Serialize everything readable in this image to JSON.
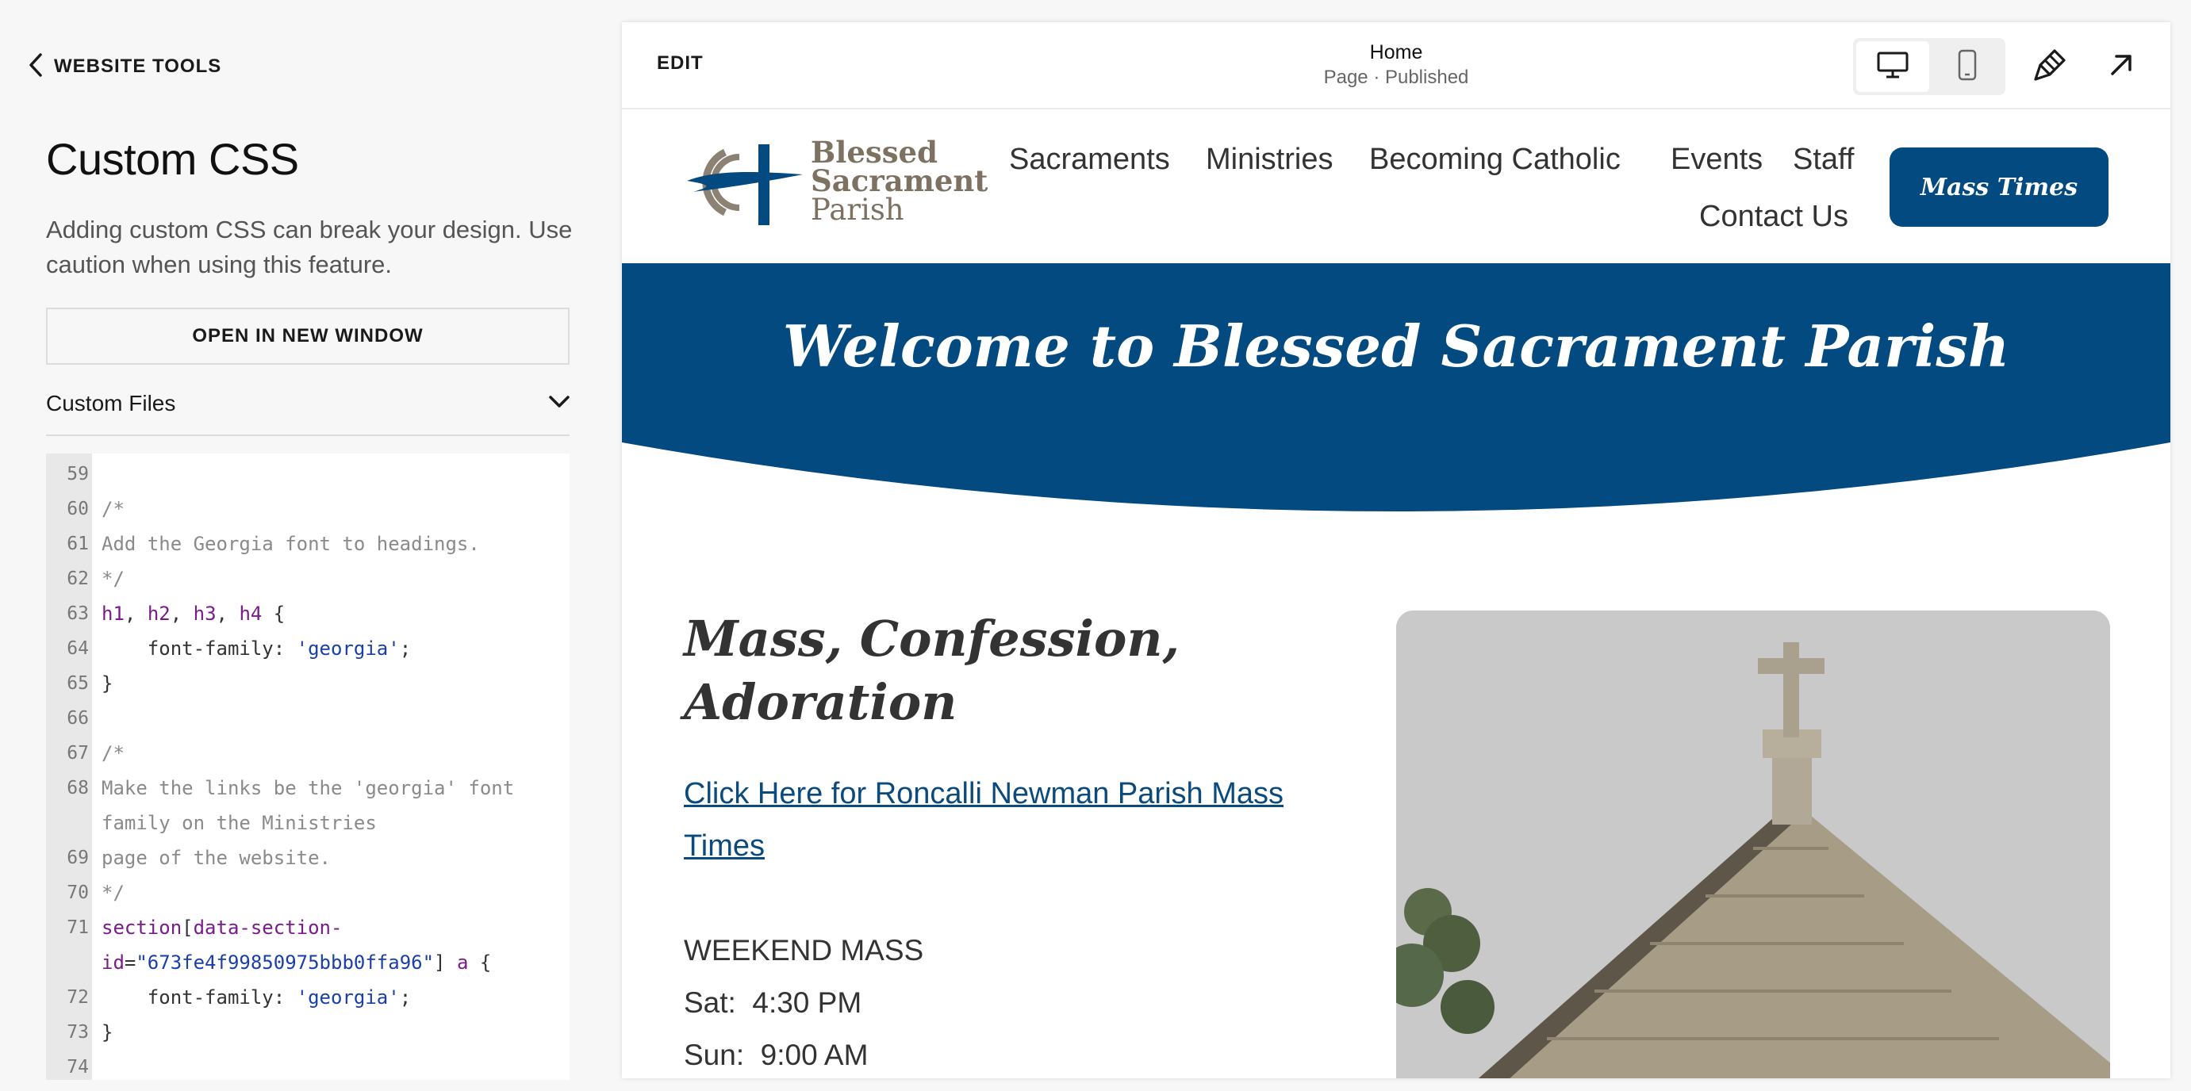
{
  "panel": {
    "back_label": "WEBSITE TOOLS",
    "title": "Custom CSS",
    "description": "Adding custom CSS can break your design. Use caution when using this feature.",
    "open_button": "OPEN IN NEW WINDOW",
    "custom_files_label": "Custom Files"
  },
  "editor": {
    "lines": [
      {
        "n": "59",
        "segments": []
      },
      {
        "n": "60",
        "segments": [
          {
            "t": "/*",
            "k": "comment"
          }
        ]
      },
      {
        "n": "61",
        "segments": [
          {
            "t": "Add the Georgia font to headings.",
            "k": "comment"
          }
        ]
      },
      {
        "n": "62",
        "segments": [
          {
            "t": "*/",
            "k": "comment"
          }
        ]
      },
      {
        "n": "63",
        "segments": [
          {
            "t": "h1",
            "k": "sel"
          },
          {
            "t": ", ",
            "k": "plain"
          },
          {
            "t": "h2",
            "k": "sel"
          },
          {
            "t": ", ",
            "k": "plain"
          },
          {
            "t": "h3",
            "k": "sel"
          },
          {
            "t": ", ",
            "k": "plain"
          },
          {
            "t": "h4",
            "k": "sel"
          },
          {
            "t": " {",
            "k": "plain"
          }
        ]
      },
      {
        "n": "64",
        "segments": [
          {
            "t": "    font-family: ",
            "k": "plain"
          },
          {
            "t": "'georgia'",
            "k": "str"
          },
          {
            "t": ";",
            "k": "plain"
          }
        ]
      },
      {
        "n": "65",
        "segments": [
          {
            "t": "}",
            "k": "plain"
          }
        ]
      },
      {
        "n": "66",
        "segments": []
      },
      {
        "n": "67",
        "segments": [
          {
            "t": "/*",
            "k": "comment"
          }
        ]
      },
      {
        "n": "68",
        "segments": [
          {
            "t": "Make the links be the 'georgia' font",
            "k": "comment"
          }
        ]
      },
      {
        "n": "",
        "segments": [
          {
            "t": "family on the Ministries",
            "k": "comment"
          }
        ]
      },
      {
        "n": "69",
        "segments": [
          {
            "t": "page of the website.",
            "k": "comment"
          }
        ]
      },
      {
        "n": "70",
        "segments": [
          {
            "t": "*/",
            "k": "comment"
          }
        ]
      },
      {
        "n": "71",
        "segments": [
          {
            "t": "section",
            "k": "sel"
          },
          {
            "t": "[",
            "k": "plain"
          },
          {
            "t": "data-section-",
            "k": "sel"
          }
        ]
      },
      {
        "n": "",
        "segments": [
          {
            "t": "id",
            "k": "sel"
          },
          {
            "t": "=",
            "k": "plain"
          },
          {
            "t": "\"673fe4f99850975bbb0ffa96\"",
            "k": "str"
          },
          {
            "t": "] ",
            "k": "plain"
          },
          {
            "t": "a",
            "k": "sel"
          },
          {
            "t": " {",
            "k": "plain"
          }
        ]
      },
      {
        "n": "72",
        "segments": [
          {
            "t": "    font-family: ",
            "k": "plain"
          },
          {
            "t": "'georgia'",
            "k": "str"
          },
          {
            "t": ";",
            "k": "plain"
          }
        ]
      },
      {
        "n": "73",
        "segments": [
          {
            "t": "}",
            "k": "plain"
          }
        ]
      },
      {
        "n": "74",
        "segments": []
      }
    ]
  },
  "topbar": {
    "edit_label": "EDIT",
    "page_name": "Home",
    "page_status": "Page · Published"
  },
  "site": {
    "logo_lines": [
      "Blessed",
      "Sacrament",
      "Parish"
    ],
    "nav": [
      "Sacraments",
      "Ministries",
      "Becoming Catholic",
      "Events",
      "Staff",
      "Contact Us"
    ],
    "cta": "Mass Times",
    "hero_title": "Welcome to Blessed Sacrament Parish",
    "section_heading": "Mass, Confession, Adoration",
    "link": "Click Here for Roncalli Newman Parish Mass Times",
    "weekend_heading": "WEEKEND MASS",
    "mass_times": [
      "Sat:  4:30 PM",
      "Sun:  9:00 AM"
    ]
  },
  "colors": {
    "brand_blue": "#024a7f",
    "logo_brown": "#7d7262",
    "link_blue": "#0b4a7c"
  }
}
